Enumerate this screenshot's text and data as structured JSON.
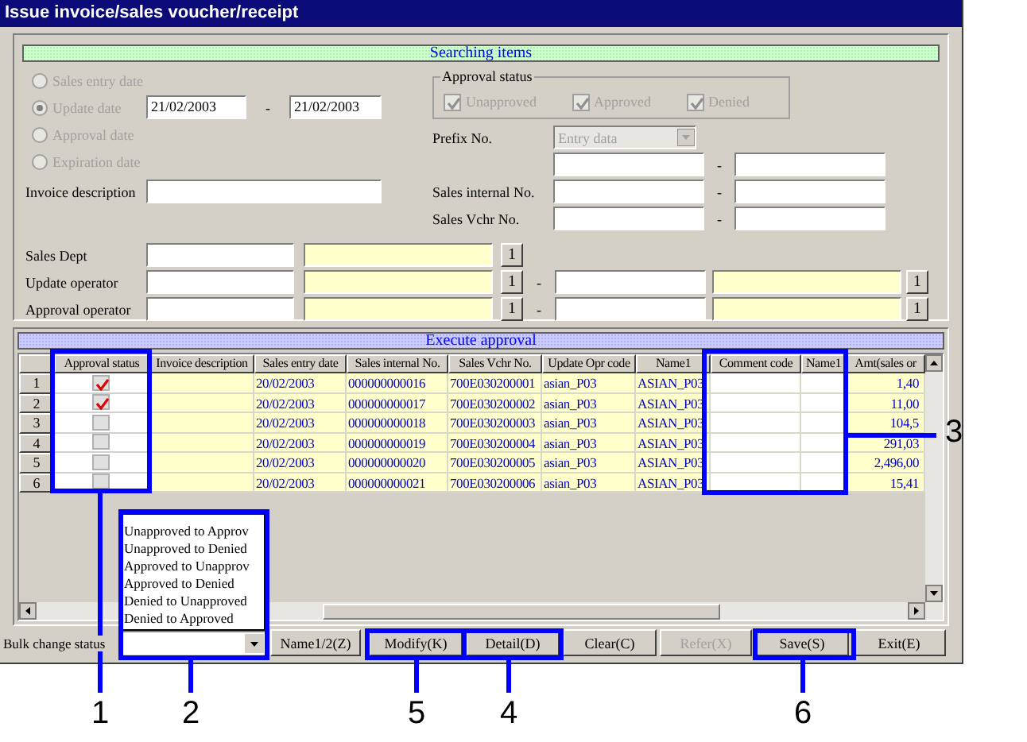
{
  "window": {
    "title": "Issue invoice/sales voucher/receipt"
  },
  "search": {
    "header": "Searching items",
    "date_options": [
      {
        "label": "Sales entry date",
        "selected": false,
        "disabled": true
      },
      {
        "label": "Update date",
        "selected": true,
        "disabled": true
      },
      {
        "label": "Approval date",
        "selected": false,
        "disabled": true
      },
      {
        "label": "Expiration date",
        "selected": false,
        "disabled": true
      }
    ],
    "date_from": "21/02/2003",
    "date_separator": "-",
    "date_to": "21/02/2003",
    "invoice_description": {
      "label": "Invoice description"
    },
    "approval_status": {
      "legend": "Approval status",
      "options": [
        {
          "label": "Unapproved",
          "checked": true,
          "disabled": true
        },
        {
          "label": "Approved",
          "checked": true,
          "disabled": true
        },
        {
          "label": "Denied",
          "checked": true,
          "disabled": true
        }
      ]
    },
    "prefix": {
      "label": "Prefix No.",
      "value": "Entry data",
      "disabled": true
    },
    "ranges": [
      {
        "separator": "-"
      },
      {
        "label": "Sales internal No.",
        "separator": "-"
      },
      {
        "label": "Sales Vchr No.",
        "separator": "-"
      }
    ],
    "operators": [
      {
        "label": "Sales Dept",
        "button": "1"
      },
      {
        "label": "Update operator",
        "button": "1",
        "separator": "-",
        "button_to": "1"
      },
      {
        "label": "Approval operator",
        "button": "1",
        "separator": "-",
        "button_to": "1"
      }
    ]
  },
  "grid": {
    "header": "Execute approval",
    "columns": [
      "Approval status",
      "Invoice description",
      "Sales entry date",
      "Sales internal No.",
      "Sales Vchr No.",
      "Update Opr code",
      "Name1",
      "Comment code",
      "Name1",
      "Amt(sales or"
    ],
    "rows": [
      {
        "number": "1",
        "checked": true,
        "entry_date": "20/02/2003",
        "internal_no": "000000000016",
        "vchr_no": "700E030200001",
        "opr_code": "asian_P03",
        "name1": "ASIAN_P03",
        "amount": "1,40"
      },
      {
        "number": "2",
        "checked": true,
        "entry_date": "20/02/2003",
        "internal_no": "000000000017",
        "vchr_no": "700E030200002",
        "opr_code": "asian_P03",
        "name1": "ASIAN_P03",
        "amount": "11,00"
      },
      {
        "number": "3",
        "checked": false,
        "entry_date": "20/02/2003",
        "internal_no": "000000000018",
        "vchr_no": "700E030200003",
        "opr_code": "asian_P03",
        "name1": "ASIAN_P03",
        "amount": "104,5"
      },
      {
        "number": "4",
        "checked": false,
        "entry_date": "20/02/2003",
        "internal_no": "000000000019",
        "vchr_no": "700E030200004",
        "opr_code": "asian_P03",
        "name1": "ASIAN_P03",
        "amount": "291,03"
      },
      {
        "number": "5",
        "checked": false,
        "entry_date": "20/02/2003",
        "internal_no": "000000000020",
        "vchr_no": "700E030200005",
        "opr_code": "asian_P03",
        "name1": "ASIAN_P03",
        "amount": "2,496,00"
      },
      {
        "number": "6",
        "checked": false,
        "entry_date": "20/02/2003",
        "internal_no": "000000000021",
        "vchr_no": "700E030200006",
        "opr_code": "asian_P03",
        "name1": "ASIAN_P03",
        "amount": "15,41"
      }
    ]
  },
  "bulk_change": {
    "label": "Bulk change status",
    "options": [
      "Unapproved to Approv",
      "Unapproved to Denied",
      "Approved to Unapprov",
      "Approved to Denied",
      "Denied to Unapproved",
      "Denied to Approved"
    ]
  },
  "buttons": [
    {
      "label": "Name1/2(Z)",
      "disabled": false
    },
    {
      "label": "Modify(K)",
      "disabled": false
    },
    {
      "label": "Detail(D)",
      "disabled": false
    },
    {
      "label": "Clear(C)",
      "disabled": false
    },
    {
      "label": "Refer(X)",
      "disabled": true
    },
    {
      "label": "Save(S)",
      "disabled": false
    },
    {
      "label": "Exit(E)",
      "disabled": false
    }
  ],
  "callouts": [
    {
      "number": "3"
    },
    {
      "number": "1"
    },
    {
      "number": "2"
    },
    {
      "number": "5"
    },
    {
      "number": "4"
    },
    {
      "number": "6"
    }
  ]
}
